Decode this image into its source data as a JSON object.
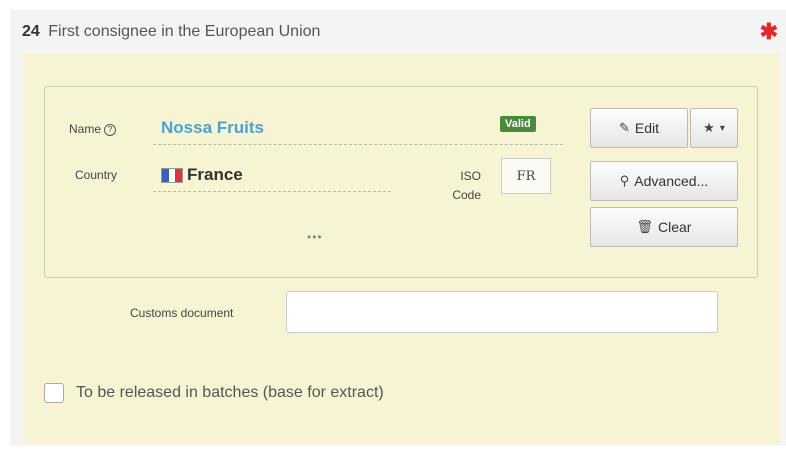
{
  "section": {
    "number": "24",
    "title": "First consignee in the European Union",
    "required_marker": "✱"
  },
  "consignee": {
    "name_label": "Name",
    "help_icon": "?",
    "name_value": "Nossa Fruits",
    "valid_badge": "Valid",
    "country_label": "Country",
    "country_value": "France",
    "iso_label": "ISO Code",
    "iso_value": "FR",
    "more_indicator": "•••"
  },
  "buttons": {
    "edit_icon": "✎",
    "edit_label": "Edit",
    "favorite_icon": "★",
    "favorite_caret": "▾",
    "advanced_icon": "⚲",
    "advanced_label": "Advanced...",
    "clear_icon": "🗑",
    "clear_label": "Clear"
  },
  "customs": {
    "label": "Customs document",
    "value": ""
  },
  "batches": {
    "label": "To be released in batches (base for extract)",
    "checked": false
  },
  "colors": {
    "panel_bg": "#f6f4d2",
    "name_link": "#4aa3cf",
    "valid_badge": "#4b8a3a",
    "required": "#e0292b",
    "flag_blue": "#3a63b8",
    "flag_white": "#ffffff",
    "flag_red": "#d9383a"
  },
  "icons": {
    "help": "question-circle-icon",
    "edit": "edit-icon",
    "favorite": "star-icon",
    "advanced": "search-icon",
    "clear": "trash-icon",
    "flag": "france-flag-icon"
  }
}
